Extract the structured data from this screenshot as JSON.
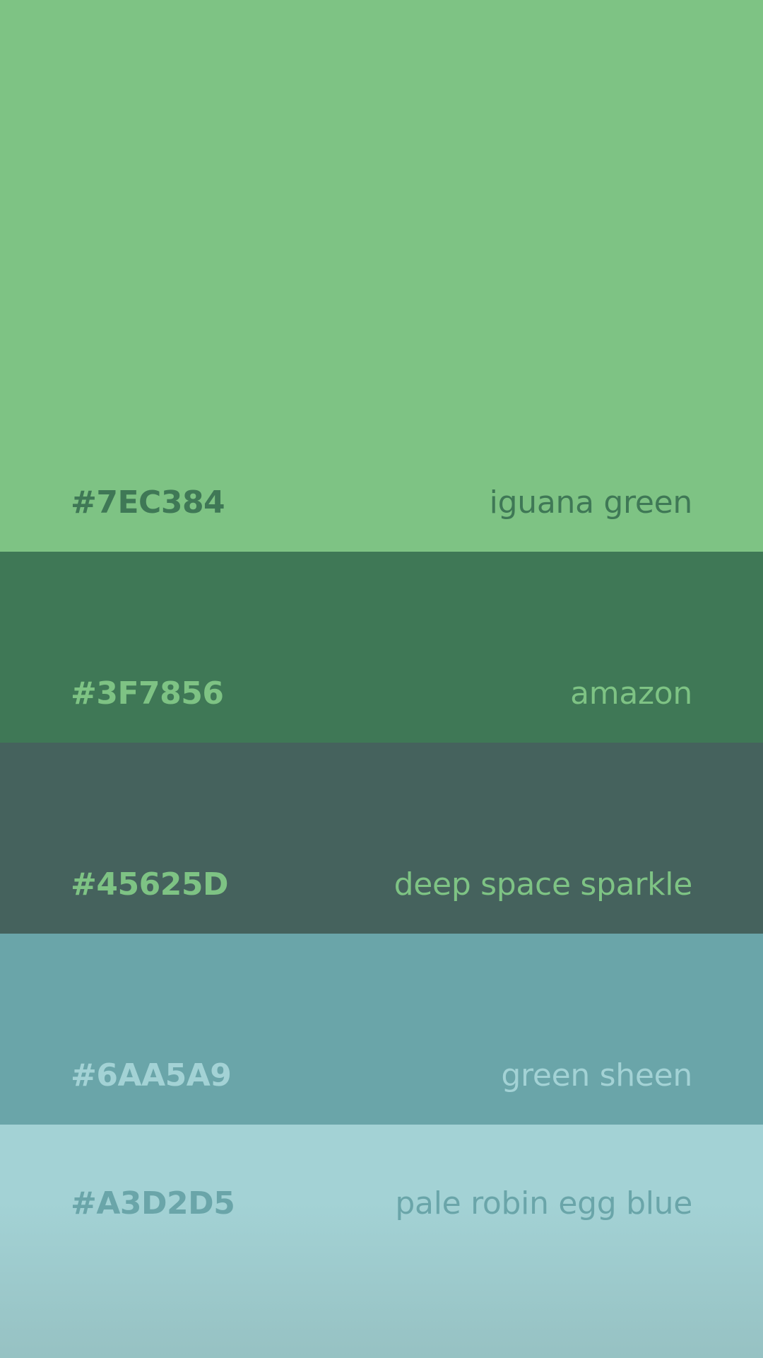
{
  "swatches": [
    {
      "hex": "#7EC384",
      "name": "iguana green",
      "bg": "#7EC384",
      "text_color": "#3F7856"
    },
    {
      "hex": "#3F7856",
      "name": "amazon",
      "bg": "#3F7856",
      "text_color": "#7EC384"
    },
    {
      "hex": "#45625D",
      "name": "deep space sparkle",
      "bg": "#45625D",
      "text_color": "#7EC384"
    },
    {
      "hex": "#6AA5A9",
      "name": "green sheen",
      "bg": "#6AA5A9",
      "text_color": "#A3D2D5"
    },
    {
      "hex": "#A3D2D5",
      "name": "pale robin egg blue",
      "bg": "#A3D2D5",
      "text_color": "#6AA5A9"
    }
  ]
}
